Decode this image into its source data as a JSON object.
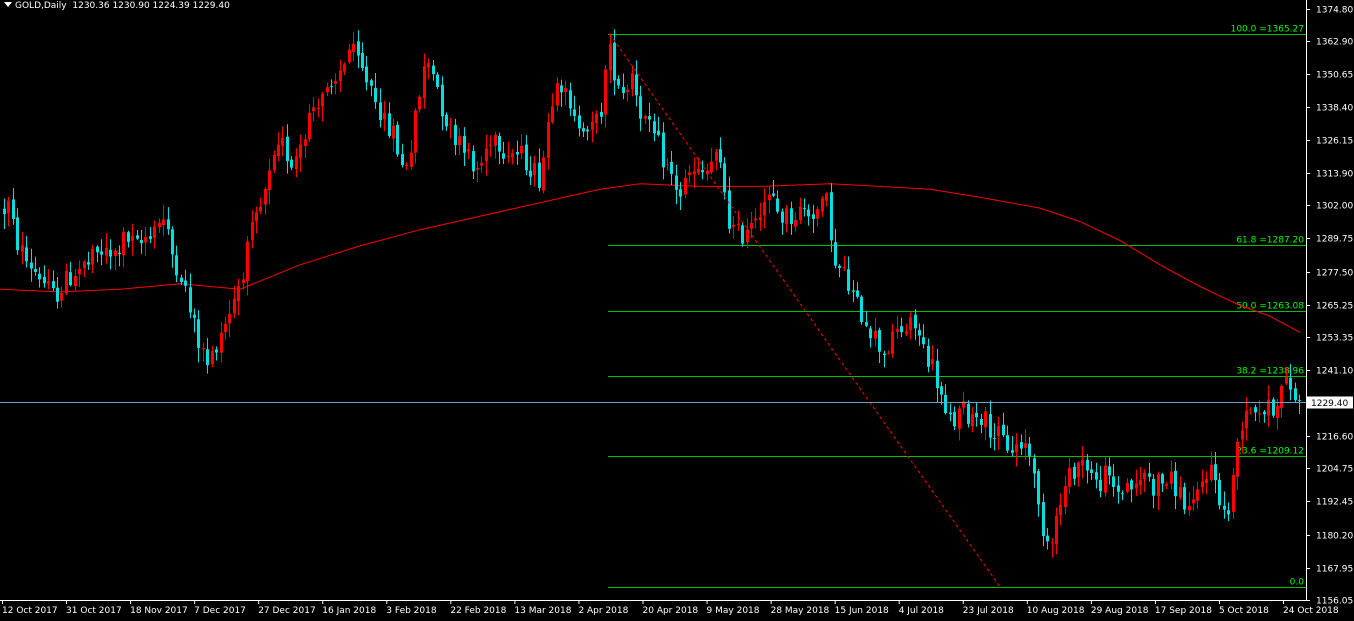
{
  "header": {
    "symbol": "GOLD,Daily",
    "ohlc": "1230.36 1230.90 1224.39 1229.40"
  },
  "colors": {
    "background": "#000000",
    "bull": "#ff0000",
    "bear": "#00e0e0",
    "moving_average": "#ff0000",
    "fib_line": "#00c000",
    "fib_text": "#00ff00",
    "price_line": "#6fa0c8",
    "axis_text": "#ffffff"
  },
  "chart_data": {
    "type": "candlestick",
    "ylim": [
      1156.0,
      1376.5
    ],
    "y_ticks": [
      1374.8,
      1362.9,
      1350.65,
      1338.4,
      1326.15,
      1313.9,
      1302.0,
      1289.75,
      1277.5,
      1265.25,
      1253.35,
      1241.1,
      1216.6,
      1204.75,
      1192.45,
      1180.2,
      1167.95,
      1156.05
    ],
    "current_price": 1229.4,
    "x_ticks": [
      "12 Oct 2017",
      "31 Oct 2017",
      "18 Nov 2017",
      "7 Dec 2017",
      "27 Dec 2017",
      "16 Jan 2018",
      "3 Feb 2018",
      "22 Feb 2018",
      "13 Mar 2018",
      "2 Apr 2018",
      "20 Apr 2018",
      "9 May 2018",
      "28 May 2018",
      "15 Jun 2018",
      "4 Jul 2018",
      "23 Jul 2018",
      "10 Aug 2018",
      "29 Aug 2018",
      "17 Sep 2018",
      "5 Oct 2018",
      "24 Oct 2018"
    ],
    "price_path": [
      [
        0,
        1298
      ],
      [
        8,
        1303
      ],
      [
        15,
        1290
      ],
      [
        25,
        1282
      ],
      [
        40,
        1276
      ],
      [
        52,
        1268
      ],
      [
        62,
        1272
      ],
      [
        75,
        1278
      ],
      [
        88,
        1280
      ],
      [
        100,
        1285
      ],
      [
        112,
        1282
      ],
      [
        125,
        1290
      ],
      [
        138,
        1286
      ],
      [
        150,
        1293
      ],
      [
        162,
        1298
      ],
      [
        172,
        1284
      ],
      [
        182,
        1276
      ],
      [
        190,
        1262
      ],
      [
        198,
        1252
      ],
      [
        208,
        1242
      ],
      [
        218,
        1254
      ],
      [
        228,
        1262
      ],
      [
        240,
        1275
      ],
      [
        252,
        1292
      ],
      [
        262,
        1302
      ],
      [
        272,
        1316
      ],
      [
        282,
        1324
      ],
      [
        292,
        1318
      ],
      [
        302,
        1328
      ],
      [
        312,
        1338
      ],
      [
        322,
        1344
      ],
      [
        332,
        1342
      ],
      [
        340,
        1352
      ],
      [
        348,
        1360
      ],
      [
        356,
        1356
      ],
      [
        364,
        1350
      ],
      [
        374,
        1345
      ],
      [
        384,
        1332
      ],
      [
        394,
        1328
      ],
      [
        402,
        1316
      ],
      [
        410,
        1322
      ],
      [
        418,
        1340
      ],
      [
        426,
        1356
      ],
      [
        434,
        1352
      ],
      [
        442,
        1338
      ],
      [
        452,
        1328
      ],
      [
        462,
        1328
      ],
      [
        472,
        1314
      ],
      [
        482,
        1318
      ],
      [
        492,
        1330
      ],
      [
        502,
        1324
      ],
      [
        512,
        1322
      ],
      [
        522,
        1320
      ],
      [
        532,
        1316
      ],
      [
        540,
        1312
      ],
      [
        548,
        1334
      ],
      [
        556,
        1352
      ],
      [
        564,
        1344
      ],
      [
        572,
        1332
      ],
      [
        582,
        1334
      ],
      [
        592,
        1330
      ],
      [
        600,
        1336
      ],
      [
        608,
        1360
      ],
      [
        616,
        1350
      ],
      [
        624,
        1344
      ],
      [
        632,
        1352
      ],
      [
        640,
        1338
      ],
      [
        648,
        1330
      ],
      [
        656,
        1326
      ],
      [
        664,
        1318
      ],
      [
        672,
        1312
      ],
      [
        680,
        1306
      ],
      [
        688,
        1313
      ],
      [
        698,
        1313
      ],
      [
        706,
        1314
      ],
      [
        714,
        1320
      ],
      [
        722,
        1314
      ],
      [
        730,
        1294
      ],
      [
        740,
        1290
      ],
      [
        748,
        1296
      ],
      [
        756,
        1300
      ],
      [
        764,
        1304
      ],
      [
        772,
        1304
      ],
      [
        780,
        1298
      ],
      [
        790,
        1298
      ],
      [
        800,
        1300
      ],
      [
        810,
        1300
      ],
      [
        820,
        1300
      ],
      [
        828,
        1304
      ],
      [
        834,
        1278
      ],
      [
        842,
        1278
      ],
      [
        850,
        1270
      ],
      [
        858,
        1264
      ],
      [
        866,
        1260
      ],
      [
        874,
        1254
      ],
      [
        882,
        1248
      ],
      [
        890,
        1250
      ],
      [
        898,
        1256
      ],
      [
        906,
        1256
      ],
      [
        914,
        1258
      ],
      [
        922,
        1250
      ],
      [
        930,
        1245
      ],
      [
        938,
        1236
      ],
      [
        946,
        1222
      ],
      [
        954,
        1222
      ],
      [
        962,
        1226
      ],
      [
        970,
        1224
      ],
      [
        978,
        1226
      ],
      [
        986,
        1222
      ],
      [
        994,
        1218
      ],
      [
        1004,
        1214
      ],
      [
        1014,
        1212
      ],
      [
        1022,
        1214
      ],
      [
        1030,
        1212
      ],
      [
        1036,
        1194
      ],
      [
        1042,
        1184
      ],
      [
        1048,
        1178
      ],
      [
        1056,
        1186
      ],
      [
        1064,
        1196
      ],
      [
        1072,
        1204
      ],
      [
        1080,
        1208
      ],
      [
        1088,
        1206
      ],
      [
        1096,
        1198
      ],
      [
        1104,
        1202
      ],
      [
        1112,
        1198
      ],
      [
        1120,
        1196
      ],
      [
        1128,
        1200
      ],
      [
        1136,
        1196
      ],
      [
        1144,
        1204
      ],
      [
        1152,
        1198
      ],
      [
        1160,
        1200
      ],
      [
        1168,
        1200
      ],
      [
        1176,
        1198
      ],
      [
        1184,
        1192
      ],
      [
        1192,
        1188
      ],
      [
        1200,
        1198
      ],
      [
        1208,
        1206
      ],
      [
        1216,
        1200
      ],
      [
        1224,
        1188
      ],
      [
        1230,
        1190
      ],
      [
        1238,
        1218
      ],
      [
        1246,
        1228
      ],
      [
        1254,
        1228
      ],
      [
        1262,
        1226
      ],
      [
        1270,
        1226
      ],
      [
        1278,
        1232
      ],
      [
        1286,
        1236
      ],
      [
        1292,
        1234
      ],
      [
        1298,
        1229
      ]
    ],
    "moving_average": [
      [
        0,
        1271
      ],
      [
        60,
        1270
      ],
      [
        120,
        1271
      ],
      [
        180,
        1273
      ],
      [
        240,
        1271
      ],
      [
        300,
        1280
      ],
      [
        360,
        1287
      ],
      [
        420,
        1293
      ],
      [
        480,
        1298
      ],
      [
        540,
        1303
      ],
      [
        600,
        1308
      ],
      [
        640,
        1310
      ],
      [
        700,
        1309
      ],
      [
        760,
        1309
      ],
      [
        830,
        1310
      ],
      [
        880,
        1309
      ],
      [
        930,
        1308
      ],
      [
        980,
        1305
      ],
      [
        1040,
        1301
      ],
      [
        1080,
        1296
      ],
      [
        1120,
        1289
      ],
      [
        1160,
        1280
      ],
      [
        1200,
        1272
      ],
      [
        1240,
        1265
      ],
      [
        1270,
        1261
      ],
      [
        1300,
        1255
      ]
    ],
    "fibonacci": [
      {
        "label": "100.0  =1365.27",
        "price": 1365.27
      },
      {
        "label": "61.8  =1287.20",
        "price": 1287.2
      },
      {
        "label": "50.0  =1263.08",
        "price": 1263.08
      },
      {
        "label": "38.2  =1238.96",
        "price": 1238.96
      },
      {
        "label": "23.6  =1209.12",
        "price": 1209.12
      },
      {
        "label": "0.0",
        "price": 1160.89
      }
    ],
    "trendline": {
      "from": [
        610,
        1365.27
      ],
      "to": [
        1000,
        1160.89
      ]
    }
  }
}
